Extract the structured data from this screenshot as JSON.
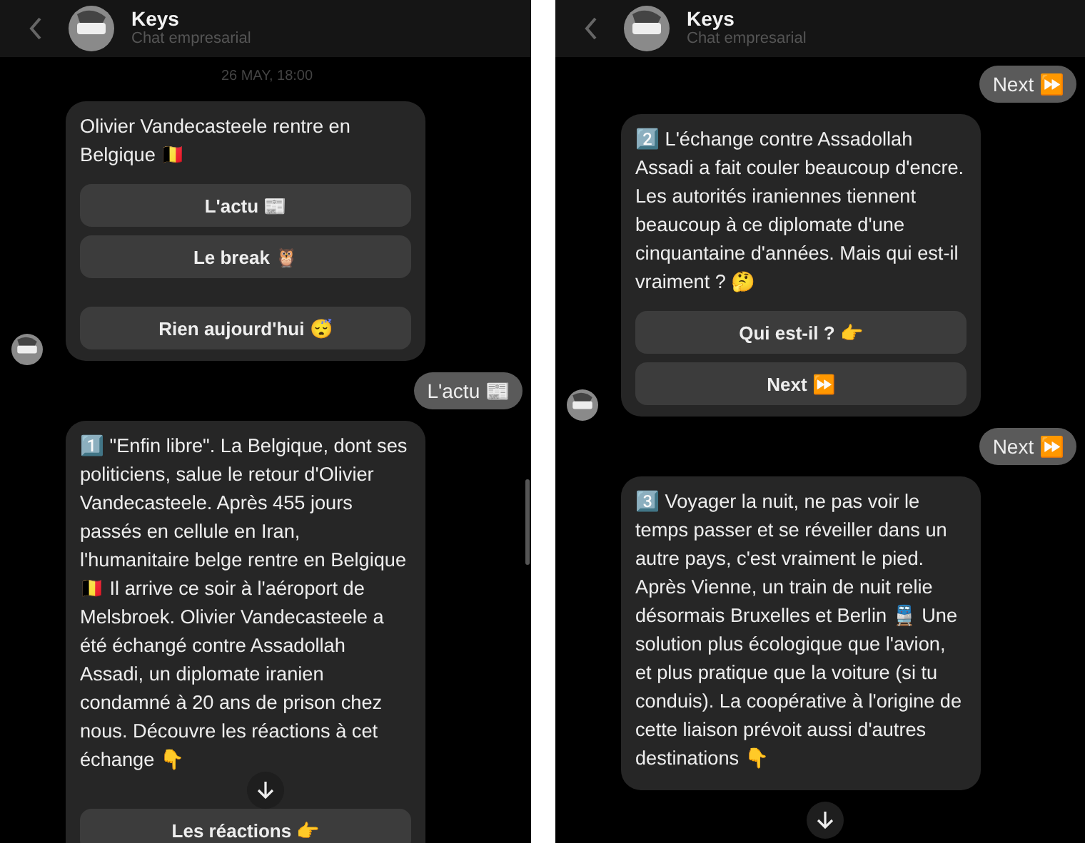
{
  "panels": [
    {
      "header": {
        "title": "Keys",
        "subtitle": "Chat empresarial"
      },
      "messages": [
        {
          "kind": "date",
          "text": "26 MAY, 18:00"
        },
        {
          "kind": "bot",
          "avatar": true,
          "text": "Olivier Vandecasteele rentre en Belgique 🇧🇪",
          "buttons": [
            {
              "label": "L'actu 📰"
            },
            {
              "label": "Le break 🦉"
            },
            {
              "label": "Rien aujourd'hui 😴"
            }
          ]
        },
        {
          "kind": "user",
          "text": "L'actu 📰"
        },
        {
          "kind": "bot",
          "avatar": false,
          "text": "1️⃣ \"Enfin libre\". La Belgique, dont ses politiciens, salue le retour d'Olivier Vandecasteele. Après 455 jours passés en cellule en Iran, l'humanitaire belge rentre en Belgique 🇧🇪 Il arrive ce soir à l'aéroport de Melsbroek. Olivier Vandecasteele a été échangé contre Assadollah Assadi, un diplomate iranien condamné à 20 ans de prison chez nous. Découvre les réactions à cet échange 👇",
          "buttons": [
            {
              "label": "Les réactions 👉"
            }
          ]
        }
      ],
      "scrollbar": true
    },
    {
      "header": {
        "title": "Keys",
        "subtitle": "Chat empresarial"
      },
      "messages": [
        {
          "kind": "user",
          "text": "Next ⏩"
        },
        {
          "kind": "bot",
          "avatar": true,
          "text": "2️⃣ L'échange contre Assadollah Assadi a fait couler beaucoup d'encre. Les autorités iraniennes tiennent beaucoup à ce diplomate d'une cinquantaine d'années. Mais qui est-il vraiment ? 🤔",
          "buttons": [
            {
              "label": "Qui est-il ? 👉"
            },
            {
              "label": "Next ⏩"
            }
          ]
        },
        {
          "kind": "user",
          "text": "Next ⏩"
        },
        {
          "kind": "bot",
          "avatar": false,
          "text": "3️⃣ Voyager la nuit, ne pas voir le temps passer et se réveiller dans un autre pays, c'est vraiment le pied. Après Vienne, un train de nuit relie désormais Bruxelles et Berlin 🚆 Une solution plus écologique que l'avion, et plus pratique que la voiture (si tu conduis). La coopérative à l'origine de cette liaison prévoit aussi d'autres destinations 👇"
        }
      ],
      "scrollbar": false
    }
  ]
}
